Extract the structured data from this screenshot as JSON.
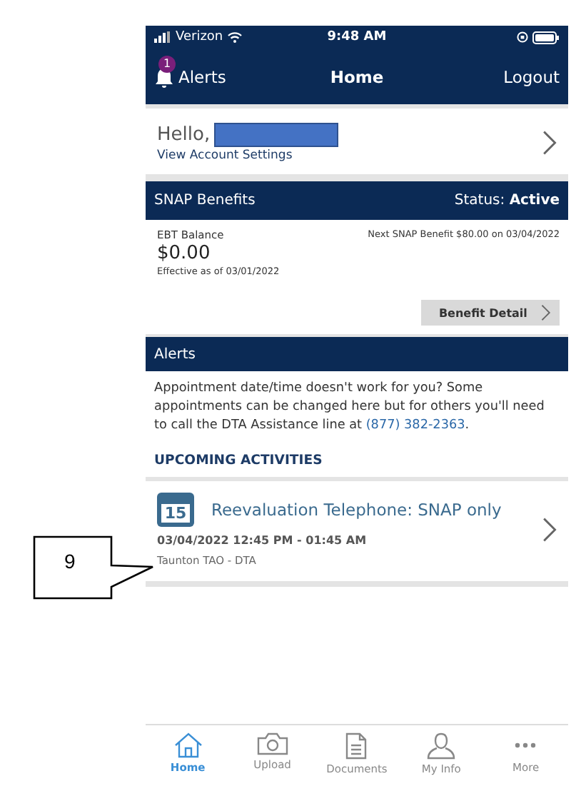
{
  "status_bar": {
    "carrier": "Verizon",
    "time": "9:48 AM"
  },
  "header": {
    "alert_count": "1",
    "alerts_label": "Alerts",
    "title": "Home",
    "logout": "Logout"
  },
  "account": {
    "greeting": "Hello,",
    "name_redacted": true,
    "link": "View Account Settings"
  },
  "snap": {
    "title": "SNAP Benefits",
    "status_label": "Status:",
    "status": "Active",
    "balance_label": "EBT Balance",
    "balance": "$0.00",
    "effective": "Effective as of 03/01/2022",
    "next_benefit": "Next SNAP Benefit $80.00 on 03/04/2022",
    "button": "Benefit Detail"
  },
  "alerts": {
    "title": "Alerts",
    "message": "Appointment date/time doesn't work for you? Some appointments can be changed here but for others you'll need to call the DTA Assistance line at ",
    "phone": "(877) 382-2363",
    "message_end": "."
  },
  "upcoming": {
    "title": "UPCOMING ACTIVITIES",
    "items": [
      {
        "calendar_day": "15",
        "title": "Reevaluation Telephone: SNAP only",
        "when": "03/04/2022 12:45 PM - 01:45 AM",
        "where": "Taunton TAO - DTA"
      }
    ]
  },
  "tabs": [
    {
      "kind": "home",
      "label": "Home",
      "selected": true
    },
    {
      "kind": "camera",
      "label": "Upload",
      "selected": false
    },
    {
      "kind": "document",
      "label": "Documents",
      "selected": false
    },
    {
      "kind": "person",
      "label": "My Info",
      "selected": false
    },
    {
      "kind": "dots",
      "label": "More",
      "selected": false
    }
  ],
  "callout": {
    "label": "9"
  }
}
